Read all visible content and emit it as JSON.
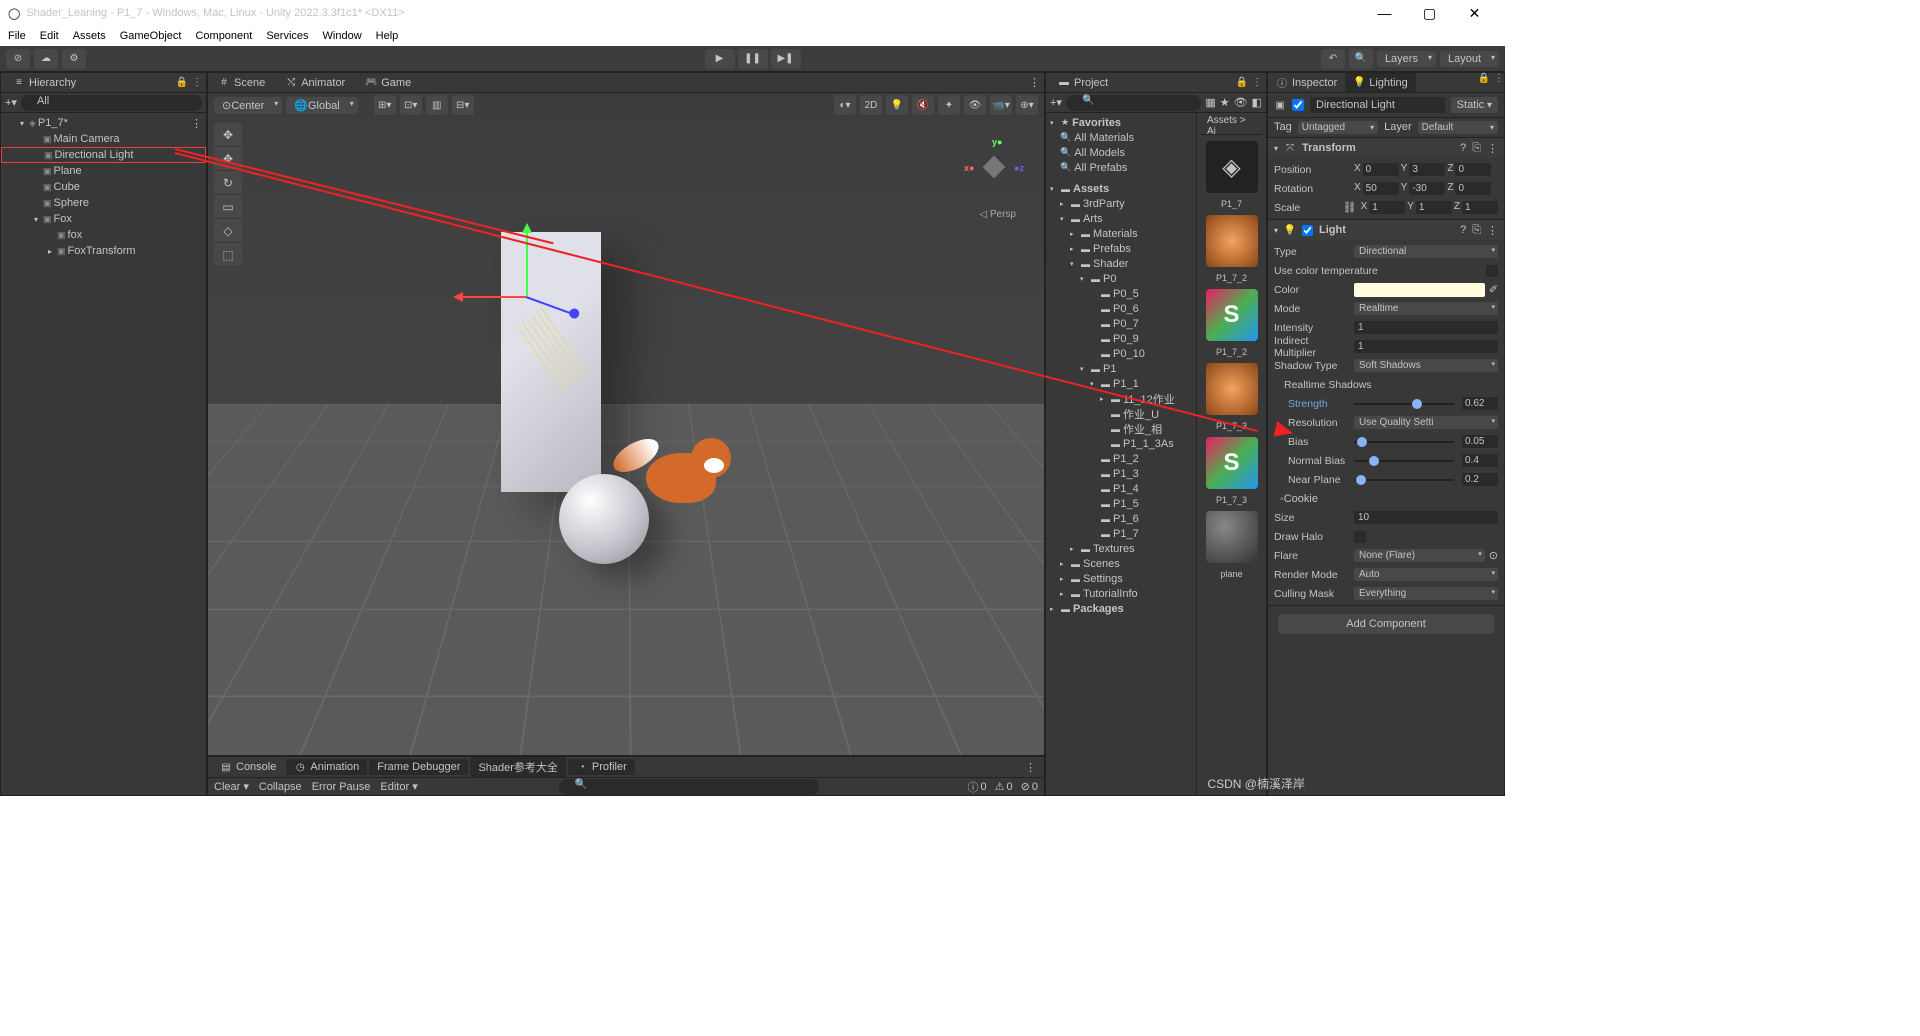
{
  "window": {
    "title": "Shader_Leaning - P1_7 - Windows, Mac, Linux - Unity 2022.3.3f1c1* <DX11>"
  },
  "menu": [
    "File",
    "Edit",
    "Assets",
    "GameObject",
    "Component",
    "Services",
    "Window",
    "Help"
  ],
  "topbar": {
    "layers": "Layers",
    "layout": "Layout"
  },
  "hierarchy": {
    "title": "Hierarchy",
    "searchPlaceholder": "All",
    "root": "P1_7*",
    "items": [
      "Main Camera",
      "Directional Light",
      "Plane",
      "Cube",
      "Sphere",
      "Fox"
    ],
    "foxChildren": [
      "fox",
      "FoxTransform"
    ]
  },
  "scene": {
    "tabs": [
      "Scene",
      "Animator",
      "Game"
    ],
    "pivot": "Center",
    "space": "Global",
    "mode2d": "2D",
    "persp": "Persp"
  },
  "viewTools": [
    "✥",
    "✥",
    "↻",
    "▭",
    "◇",
    "⬚"
  ],
  "console": {
    "tabs": [
      "Console",
      "Animation",
      "Frame Debugger",
      "Shader参考大全",
      "Profiler"
    ],
    "clear": "Clear",
    "collapse": "Collapse",
    "errorPause": "Error Pause",
    "editor": "Editor",
    "counts": {
      "info": "0",
      "warn": "0",
      "err": "0"
    }
  },
  "project": {
    "title": "Project",
    "breadcrumb": "Assets > Ai",
    "favorites": "Favorites",
    "favItems": [
      "All Materials",
      "All Models",
      "All Prefabs"
    ],
    "assets": "Assets",
    "tree": [
      {
        "l": 1,
        "f": "▸",
        "n": "3rdParty"
      },
      {
        "l": 1,
        "f": "▾",
        "n": "Arts"
      },
      {
        "l": 2,
        "f": "▸",
        "n": "Materials"
      },
      {
        "l": 2,
        "f": "▸",
        "n": "Prefabs"
      },
      {
        "l": 2,
        "f": "▾",
        "n": "Shader"
      },
      {
        "l": 3,
        "f": "▾",
        "n": "P0"
      },
      {
        "l": 4,
        "f": "",
        "n": "P0_5"
      },
      {
        "l": 4,
        "f": "",
        "n": "P0_6"
      },
      {
        "l": 4,
        "f": "",
        "n": "P0_7"
      },
      {
        "l": 4,
        "f": "",
        "n": "P0_9"
      },
      {
        "l": 4,
        "f": "",
        "n": "P0_10"
      },
      {
        "l": 3,
        "f": "▾",
        "n": "P1"
      },
      {
        "l": 4,
        "f": "▾",
        "n": "P1_1"
      },
      {
        "l": 5,
        "f": "▸",
        "n": "11_12作业"
      },
      {
        "l": 5,
        "f": "",
        "n": "作业_U"
      },
      {
        "l": 5,
        "f": "",
        "n": "作业_相"
      },
      {
        "l": 5,
        "f": "",
        "n": "P1_1_3As"
      },
      {
        "l": 4,
        "f": "",
        "n": "P1_2"
      },
      {
        "l": 4,
        "f": "",
        "n": "P1_3"
      },
      {
        "l": 4,
        "f": "",
        "n": "P1_4"
      },
      {
        "l": 4,
        "f": "",
        "n": "P1_5"
      },
      {
        "l": 4,
        "f": "",
        "n": "P1_6"
      },
      {
        "l": 4,
        "f": "",
        "n": "P1_7"
      },
      {
        "l": 2,
        "f": "▸",
        "n": "Textures"
      },
      {
        "l": 1,
        "f": "▸",
        "n": "Scenes"
      },
      {
        "l": 1,
        "f": "▸",
        "n": "Settings"
      },
      {
        "l": 1,
        "f": "▸",
        "n": "TutorialInfo"
      }
    ],
    "packages": "Packages",
    "thumbs": [
      "P1_7",
      "P1_7_2",
      "P1_7_2",
      "P1_7_3",
      "P1_7_3",
      "plane"
    ]
  },
  "inspector": {
    "tabs": [
      "Inspector",
      "Lighting"
    ],
    "name": "Directional Light",
    "static": "Static",
    "tagLbl": "Tag",
    "tag": "Untagged",
    "layerLbl": "Layer",
    "layer": "Default",
    "transform": {
      "title": "Transform",
      "pos": {
        "lbl": "Position",
        "x": "0",
        "y": "3",
        "z": "0"
      },
      "rot": {
        "lbl": "Rotation",
        "x": "50",
        "y": "-30",
        "z": "0"
      },
      "sca": {
        "lbl": "Scale",
        "x": "1",
        "y": "1",
        "z": "1"
      }
    },
    "light": {
      "title": "Light",
      "typeLbl": "Type",
      "type": "Directional",
      "colorTempLbl": "Use color temperature",
      "colorLbl": "Color",
      "modeLbl": "Mode",
      "mode": "Realtime",
      "intensityLbl": "Intensity",
      "intensity": "1",
      "indirectLbl": "Indirect Multiplier",
      "indirect": "1",
      "shadowTypeLbl": "Shadow Type",
      "shadowType": "Soft Shadows",
      "rtShadowsLbl": "Realtime Shadows",
      "strengthLbl": "Strength",
      "strength": "0.62",
      "resolutionLbl": "Resolution",
      "resolution": "Use Quality Setti",
      "biasLbl": "Bias",
      "bias": "0.05",
      "normalBiasLbl": "Normal Bias",
      "normalBias": "0.4",
      "nearPlaneLbl": "Near Plane",
      "nearPlane": "0.2",
      "cookieLbl": "Cookie",
      "sizeLbl": "Size",
      "size": "10",
      "drawHaloLbl": "Draw Halo",
      "flareLbl": "Flare",
      "flare": "None (Flare)",
      "renderModeLbl": "Render Mode",
      "renderMode": "Auto",
      "cullingMaskLbl": "Culling Mask",
      "cullingMask": "Everything"
    },
    "addComponent": "Add Component"
  },
  "watermark": "CSDN @楠溪泽岸"
}
